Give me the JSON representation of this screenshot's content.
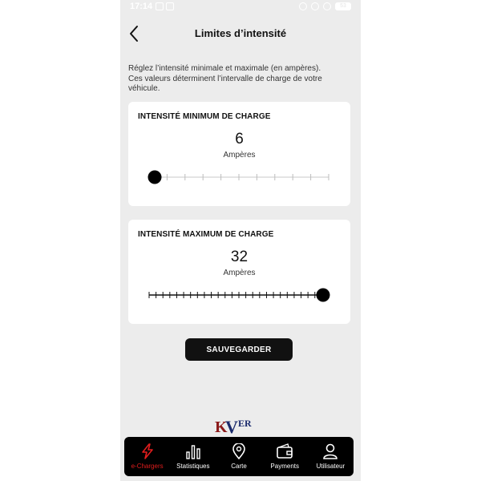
{
  "status_bar": {
    "time": "17:14",
    "battery": "53"
  },
  "header": {
    "title": "Limites d’intensité",
    "back_icon": "chevron-left-icon"
  },
  "description": {
    "line1": "Réglez l’intensité minimale et maximale (en ampères).",
    "line2": "Ces valeurs déterminent l’intervalle de charge de votre",
    "line3": "véhicule."
  },
  "min_card": {
    "title": "INTENSITÉ MINIMUM DE CHARGE",
    "value": "6",
    "unit": "Ampères",
    "slider": {
      "min": 6,
      "max": 16,
      "value": 6
    }
  },
  "max_card": {
    "title": "INTENSITÉ MAXIMUM DE CHARGE",
    "value": "32",
    "unit": "Ampères",
    "slider": {
      "min": 6,
      "max": 32,
      "value": 32
    }
  },
  "save_label": "SAUVEGARDER",
  "logo": {
    "text": "KVER"
  },
  "nav": {
    "items": [
      {
        "label": "e-Chargers",
        "icon": "bolt-icon",
        "active": true
      },
      {
        "label": "Statistiques",
        "icon": "bar-chart-icon",
        "active": false
      },
      {
        "label": "Carte",
        "icon": "map-pin-icon",
        "active": false
      },
      {
        "label": "Payments",
        "icon": "wallet-icon",
        "active": false
      },
      {
        "label": "Utilisateur",
        "icon": "user-icon",
        "active": false
      }
    ]
  },
  "colors": {
    "background": "#ececec",
    "card": "#ffffff",
    "accent_active": "#e11d1d",
    "nav_background": "#000000",
    "button": "#111111",
    "logo_dark_red": "#8b1a1a",
    "logo_navy": "#1a2a6c"
  }
}
